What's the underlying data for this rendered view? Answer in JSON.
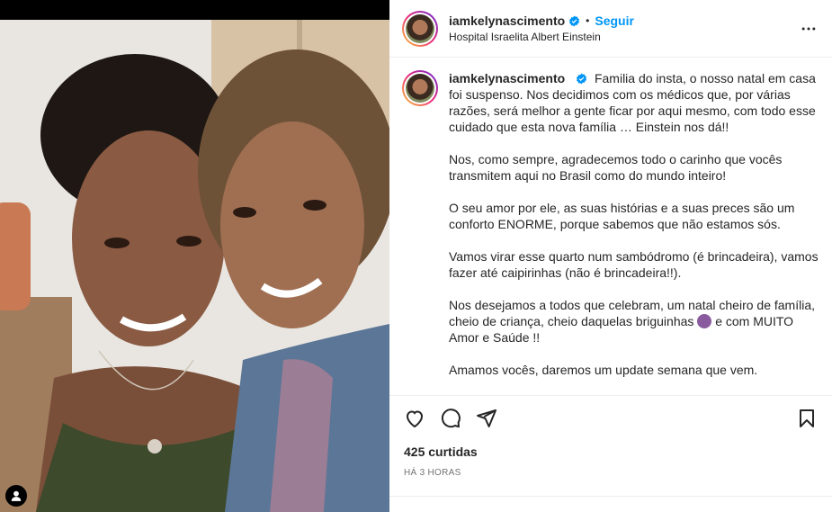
{
  "post": {
    "username": "iamkelynascimento",
    "follow_label": "Seguir",
    "separator": "•",
    "location": "Hospital Israelita Albert Einstein",
    "caption_paragraphs": [
      "Familia do insta, o nosso natal em casa foi suspenso. Nos decidimos com os médicos que, por várias razões, será melhor a gente ficar por aqui mesmo, com todo esse cuidado que esta nova família … Einstein nos dá!!",
      "Nos, como sempre, agradecemos todo o carinho que vocês transmitem aqui no Brasil como do mundo inteiro!",
      "O seu amor por ele, as suas histórias e a suas preces são um conforto ENORME, porque sabemos que não estamos sós.",
      "Vamos virar esse quarto num sambódromo (é brincadeira), vamos fazer até caipirinhas (não é brincadeira!!).",
      "Nos desejamos a todos que celebram, um natal cheiro de família, cheio de criança, cheio daquelas briguinhas",
      "e com MUITO Amor e Saúde !!",
      "Amamos vocês, daremos um update semana que vem."
    ],
    "likes": "425 curtidas",
    "timestamp": "HÁ 3 HORAS"
  },
  "icons": {
    "verified": "verified-badge-icon",
    "more": "more-options-icon",
    "like": "heart-icon",
    "comment": "comment-icon",
    "share": "share-icon",
    "save": "bookmark-icon",
    "tag": "user-tag-icon"
  },
  "colors": {
    "accent": "#0095f6",
    "text": "#262626",
    "muted": "#737373"
  }
}
